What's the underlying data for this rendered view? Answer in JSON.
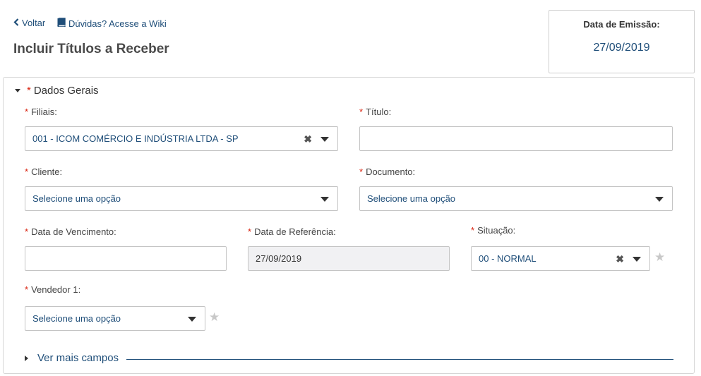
{
  "nav": {
    "back_label": "Voltar",
    "wiki_label": "Dúvidas? Acesse a Wiki"
  },
  "page": {
    "title": "Incluir Títulos a Receber"
  },
  "emission": {
    "label": "Data de Emissão:",
    "value": "27/09/2019"
  },
  "section": {
    "title": "Dados Gerais"
  },
  "required_mark": "*",
  "fields": {
    "filiais": {
      "label": "Filiais:",
      "value": "001 - ICOM COMÉRCIO E INDÚSTRIA LTDA - SP"
    },
    "titulo": {
      "label": "Título:",
      "value": ""
    },
    "cliente": {
      "label": "Cliente:",
      "value": "Selecione uma opção"
    },
    "documento": {
      "label": "Documento:",
      "value": "Selecione uma opção"
    },
    "vencimento": {
      "label": "Data de Vencimento:",
      "value": ""
    },
    "referencia": {
      "label": "Data de Referência:",
      "value": "27/09/2019"
    },
    "situacao": {
      "label": "Situação:",
      "value": "00 - NORMAL"
    },
    "vendedor": {
      "label": "Vendedor 1:",
      "value": "Selecione uma opção"
    }
  },
  "more": {
    "label": "Ver mais campos"
  },
  "icons": {
    "back": "chevron-left-icon",
    "wiki": "book-icon",
    "clear": "clear-x-icon",
    "dropdown": "caret-down-icon",
    "favorite": "star-icon"
  },
  "colors": {
    "accent": "#1f4e79",
    "required": "#d9230f"
  }
}
